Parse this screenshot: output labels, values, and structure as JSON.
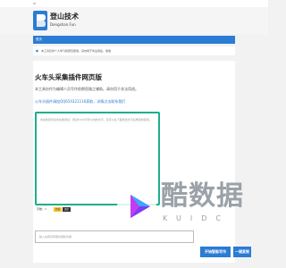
{
  "topbar": {
    "text": "8T"
  },
  "brand": {
    "title": "登山技术",
    "subtitle": "Dengshan.Fun"
  },
  "nav": {
    "items": [
      {
        "label": "首页"
      }
    ]
  },
  "notice": {
    "text": "本工具仅供个人学习和研究使用，请勿用于商业用途，谢谢"
  },
  "main": {
    "title": "火车头采集插件网页版",
    "description": "本工具仅作为编辑人员写作前期思路之辅助。请勿用于非法用途。",
    "contact": "火车头插件请加QQ654321116获取，详情点击联系我们",
    "textarea_placeholder": "本站伪原创基本功能测试，测试5000字符以内的文字。您可以在下面修改文字后再复制使用。",
    "counter_label": "字数：",
    "counter_value": "0",
    "badge_yellow": "复制",
    "badge_dark": "清空",
    "input_placeholder": "输入关键词获取标题和内容",
    "btn_primary": "开始智能写作",
    "btn_secondary": "一键复制"
  },
  "watermark": {
    "text": "酷数据",
    "subtext": "KUIDC"
  },
  "colors": {
    "accent": "#2b7cd3",
    "border_green": "#1fae8c",
    "badge_yellow": "#f4c430"
  }
}
